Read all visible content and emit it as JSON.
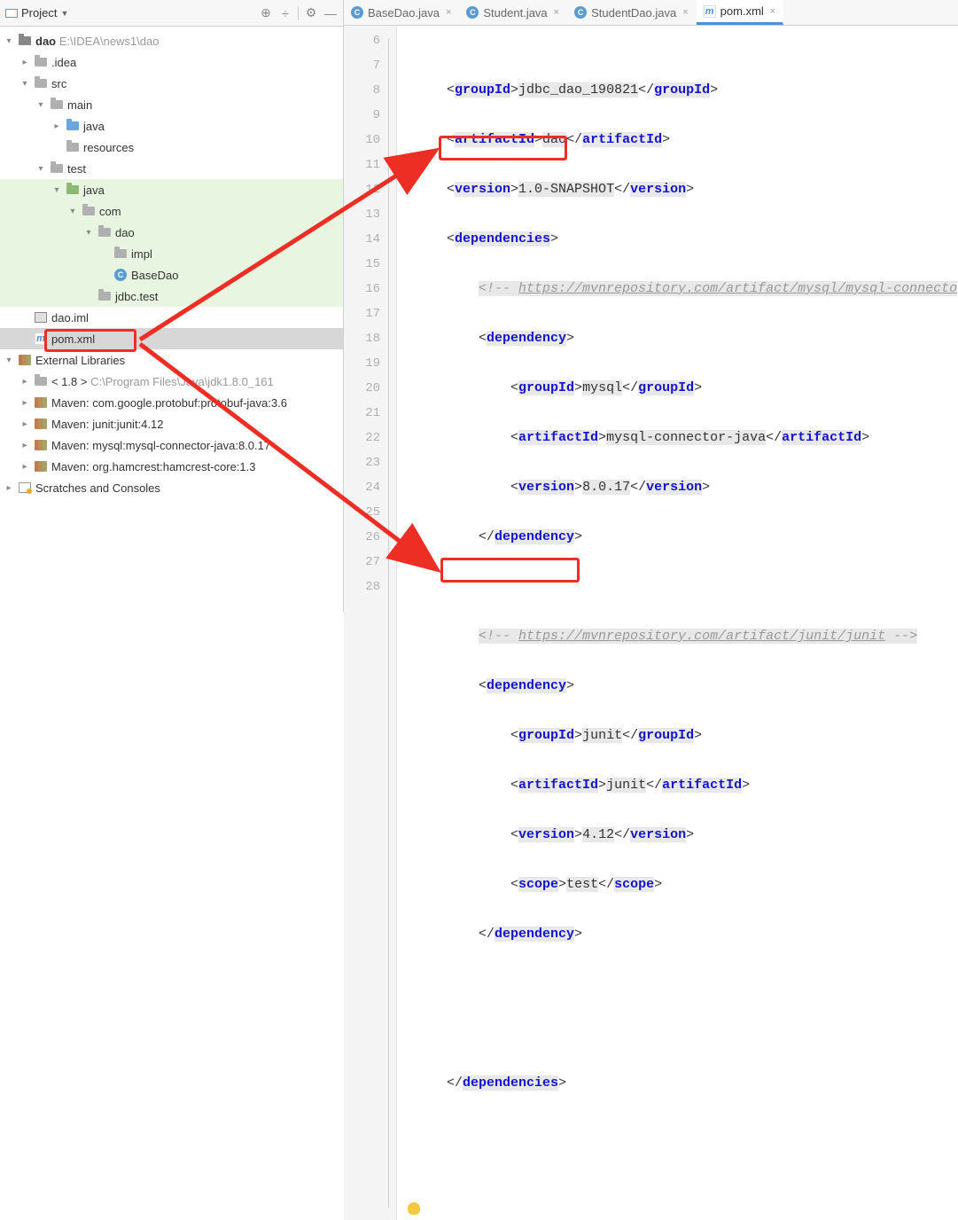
{
  "toolbar": {
    "project_label": "Project"
  },
  "tree": {
    "root": {
      "name": "dao",
      "path": "E:\\IDEA\\news1\\dao"
    },
    "idea": ".idea",
    "src": "src",
    "main": "main",
    "java": "java",
    "resources": "resources",
    "test": "test",
    "java2": "java",
    "com": "com",
    "dao": "dao",
    "impl": "impl",
    "basedao": "BaseDao",
    "jdbctest": "jdbc.test",
    "daoiml": "dao.iml",
    "pom": "pom.xml",
    "extlibs": "External Libraries",
    "jdk": {
      "name": "< 1.8 >",
      "path": "C:\\Program Files\\Java\\jdk1.8.0_161"
    },
    "mvn1": "Maven: com.google.protobuf:protobuf-java:3.6",
    "mvn2": "Maven: junit:junit:4.12",
    "mvn3": "Maven: mysql:mysql-connector-java:8.0.17",
    "mvn4": "Maven: org.hamcrest:hamcrest-core:1.3",
    "scratch": "Scratches and Consoles"
  },
  "tabs": {
    "t1": "BaseDao.java",
    "t2": "Student.java",
    "t3": "StudentDao.java",
    "t4": "pom.xml"
  },
  "lines": [
    "6",
    "7",
    "8",
    "9",
    "10",
    "11",
    "12",
    "13",
    "14",
    "15",
    "16",
    "17",
    "18",
    "19",
    "20",
    "21",
    "22",
    "23",
    "24",
    "25",
    "26",
    "27",
    "28"
  ],
  "code": {
    "l7_open": "groupId",
    "l7_text": "jdbc_dao_190821",
    "l8_open": "artifactId",
    "l8_text": "dao",
    "l9_open": "version",
    "l9_text": "1.0-SNAPSHOT",
    "l10": "dependencies",
    "l11_c": "<!-- ",
    "l11_link": "https://mvnrepository.com/artifact/mysql/mysql-connecto",
    "l12": "dependency",
    "l13_open": "groupId",
    "l13_text": "mysql",
    "l14_open": "artifactId",
    "l14_text": "mysql-connector-java",
    "l15_open": "version",
    "l15_text": "8.0.17",
    "l16": "dependency",
    "l18_c": "<!-- ",
    "l18_link": "https://mvnrepository.com/artifact/junit/junit",
    "l18_end": " -->",
    "l19": "dependency",
    "l20_open": "groupId",
    "l20_text": "junit",
    "l21_open": "artifactId",
    "l21_text": "junit",
    "l22_open": "version",
    "l22_text": "4.12",
    "l23_open": "scope",
    "l23_text": "test",
    "l24": "dependency",
    "l27": "dependencies"
  }
}
